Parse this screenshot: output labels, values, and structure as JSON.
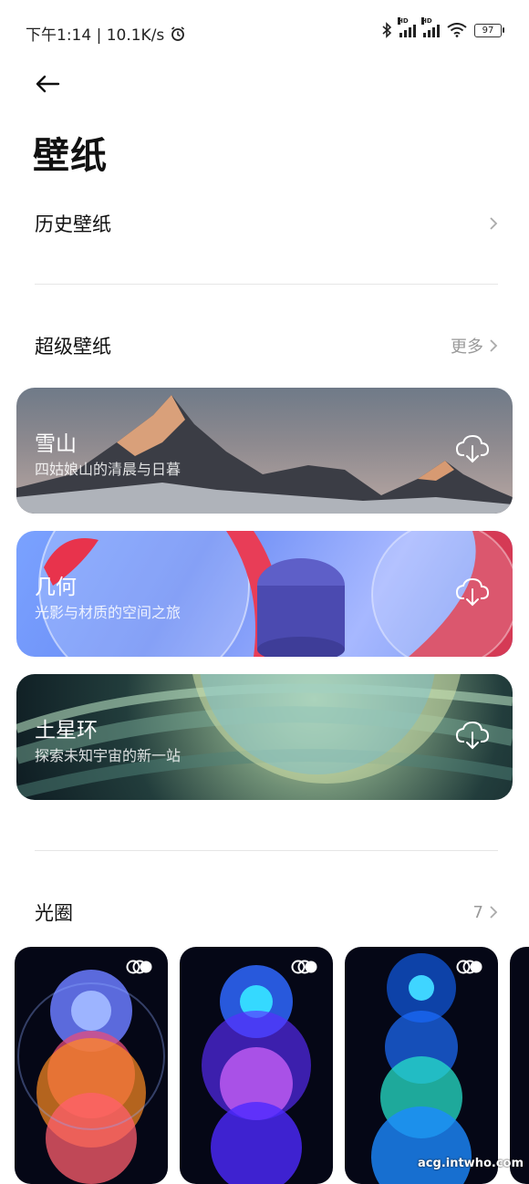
{
  "status": {
    "time": "下午1:14 | 10.1K/s",
    "battery": "97",
    "hd1": "HD",
    "hd2": "HD"
  },
  "header": {
    "title": "壁纸"
  },
  "history": {
    "label": "历史壁纸"
  },
  "super": {
    "label": "超级壁纸",
    "more": "更多",
    "cards": [
      {
        "title": "雪山",
        "subtitle": "四姑娘山的清晨与日暮"
      },
      {
        "title": "几何",
        "subtitle": "光影与材质的空间之旅"
      },
      {
        "title": "土星环",
        "subtitle": "探索未知宇宙的新一站"
      }
    ]
  },
  "aperture": {
    "label": "光圈",
    "count": "7"
  },
  "watermark": "acg.intwho.com"
}
